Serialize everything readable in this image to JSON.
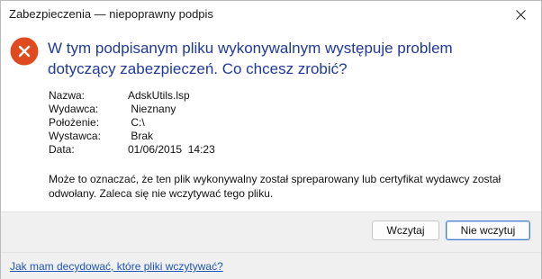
{
  "window": {
    "title": "Zabezpieczenia — niepoprawny podpis"
  },
  "icons": {
    "close": "close-icon",
    "error": "error-circle-x-icon",
    "error_color": "#e04a1f"
  },
  "headline": "W tym podpisanym pliku wykonywalnym występuje problem dotyczący zabezpieczeń. Co chcesz zrobić?",
  "details": {
    "name_label": "Nazwa:",
    "name_value": "AdskUtils.lsp",
    "publisher_label": "Wydawca:",
    "publisher_value": " Nieznany",
    "location_label": "Położenie:",
    "location_value": " C:\\",
    "issuer_label": "Wystawca:",
    "issuer_value": " Brak",
    "date_label": "Data:",
    "date_value": "01/06/2015  14:23"
  },
  "message": "Może to oznaczać, że ten plik wykonywalny został spreparowany lub certyfikat wydawcy został odwołany. Zaleca się nie wczytywać tego pliku.",
  "buttons": {
    "load": "Wczytaj",
    "dont_load": "Nie wczytuj"
  },
  "help_link": "Jak mam decydować, które pliki wczytywać?"
}
